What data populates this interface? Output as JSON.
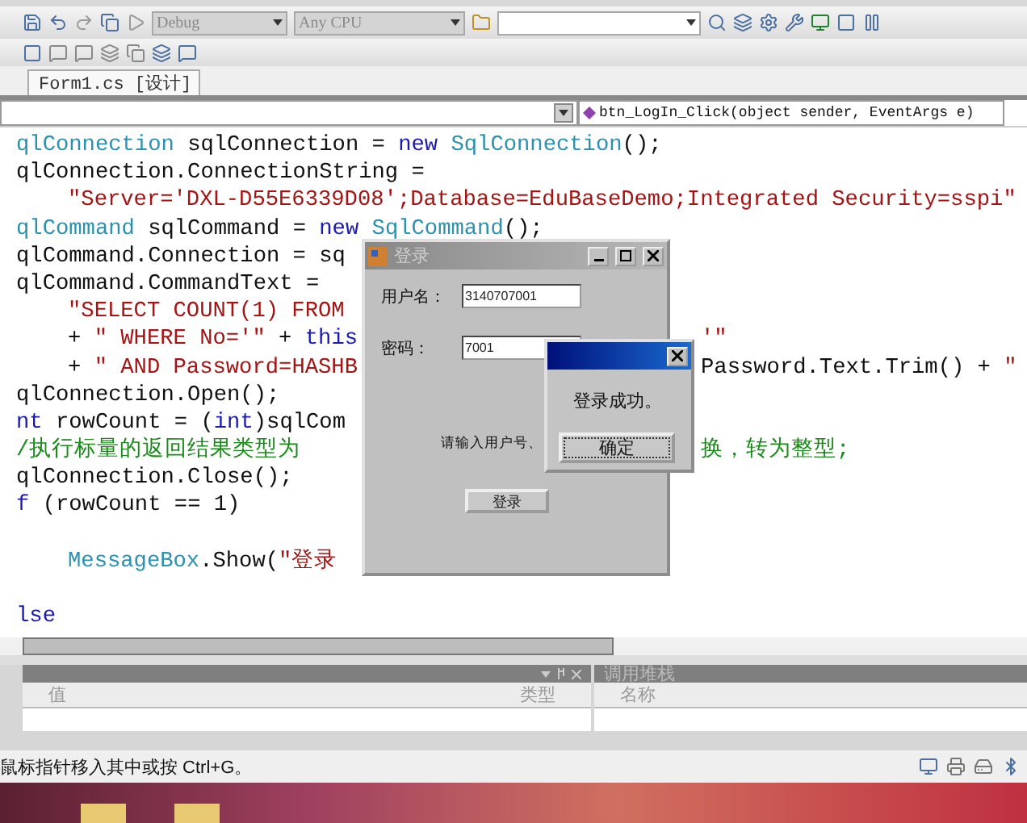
{
  "toolbar": {
    "configuration": "Debug",
    "platform": "Any CPU"
  },
  "document_tab": {
    "label": "Form1.cs [设计]",
    "selected": true
  },
  "nav_bar": {
    "member": "btn_LogIn_Click(object sender, EventArgs e)"
  },
  "code_lines": [
    {
      "indented": false,
      "blank_before": false,
      "segments": [
        {
          "kind": "type",
          "text": "qlConnection"
        },
        {
          "kind": "plain",
          "text": " sqlConnection = "
        },
        {
          "kind": "keyword",
          "text": "new"
        },
        {
          "kind": "type",
          "text": " SqlConnection"
        },
        {
          "kind": "plain",
          "text": "();"
        }
      ]
    },
    {
      "indented": false,
      "blank_before": false,
      "segments": [
        {
          "kind": "plain",
          "text": "qlConnection.ConnectionString ="
        }
      ]
    },
    {
      "indented": true,
      "blank_before": false,
      "segments": [
        {
          "kind": "string",
          "text": "\"Server='DXL-D55E6339D08';Database=EduBaseDemo;Integrated Security=sspi\""
        }
      ]
    },
    {
      "indented": false,
      "blank_before": false,
      "segments": [
        {
          "kind": "type",
          "text": "qlCommand"
        },
        {
          "kind": "plain",
          "text": " sqlCommand = "
        },
        {
          "kind": "keyword",
          "text": "new"
        },
        {
          "kind": "type",
          "text": " SqlCommand"
        },
        {
          "kind": "plain",
          "text": "();"
        }
      ]
    },
    {
      "indented": false,
      "blank_before": false,
      "segments": [
        {
          "kind": "plain",
          "text": "qlCommand.Connection = sq"
        }
      ]
    },
    {
      "indented": false,
      "blank_before": false,
      "segments": [
        {
          "kind": "plain",
          "text": "qlCommand.CommandText ="
        }
      ]
    },
    {
      "indented": true,
      "blank_before": false,
      "segments": [
        {
          "kind": "string",
          "text": "\"SELECT COUNT(1) FROM"
        }
      ]
    },
    {
      "indented": true,
      "blank_before": false,
      "segments": [
        {
          "kind": "plain",
          "text": "+ "
        },
        {
          "kind": "string",
          "text": "\" WHERE No='\""
        },
        {
          "kind": "plain",
          "text": " + "
        },
        {
          "kind": "keyword",
          "text": "this"
        }
      ],
      "tail": [
        {
          "kind": "string",
          "text": "'\""
        }
      ]
    },
    {
      "indented": true,
      "blank_before": false,
      "segments": [
        {
          "kind": "plain",
          "text": "+ "
        },
        {
          "kind": "string",
          "text": "\" AND Password=HASHB"
        }
      ],
      "tail": [
        {
          "kind": "plain",
          "text": "Password.Text.Trim() + "
        },
        {
          "kind": "string",
          "text": "\""
        }
      ]
    },
    {
      "indented": false,
      "blank_before": false,
      "segments": [
        {
          "kind": "plain",
          "text": "qlConnection.Open();"
        }
      ]
    },
    {
      "indented": false,
      "blank_before": false,
      "segments": [
        {
          "kind": "keyword",
          "text": "nt"
        },
        {
          "kind": "plain",
          "text": " rowCount = ("
        },
        {
          "kind": "keyword",
          "text": "int"
        },
        {
          "kind": "plain",
          "text": ")sqlCom"
        }
      ]
    },
    {
      "indented": false,
      "blank_before": false,
      "segments": [
        {
          "kind": "comment",
          "text": "/执行标量的返回结果类型为"
        }
      ],
      "tail": [
        {
          "kind": "comment",
          "text": "换，转为整型;"
        }
      ]
    },
    {
      "indented": false,
      "blank_before": false,
      "segments": [
        {
          "kind": "plain",
          "text": "qlConnection.Close();"
        }
      ]
    },
    {
      "indented": false,
      "blank_before": false,
      "segments": [
        {
          "kind": "keyword",
          "text": "f"
        },
        {
          "kind": "plain",
          "text": " (rowCount == 1)"
        }
      ]
    },
    {
      "indented": true,
      "blank_before": true,
      "segments": [
        {
          "kind": "type",
          "text": "MessageBox"
        },
        {
          "kind": "plain",
          "text": ".Show("
        },
        {
          "kind": "string",
          "text": "\"登录"
        }
      ]
    },
    {
      "indented": false,
      "blank_before": true,
      "segments": [
        {
          "kind": "keyword",
          "text": "lse"
        }
      ]
    }
  ],
  "bottom_panels": {
    "locals": {
      "columns": [
        "值",
        "类型"
      ]
    },
    "call_stack": {
      "title": "调用堆栈",
      "columns": [
        "名称"
      ]
    }
  },
  "status_bar": "鼠标指针移入其中或按 Ctrl+G。",
  "login_dialog": {
    "title": "登录",
    "fields": [
      {
        "label": "用户名：",
        "value": "3140707001"
      },
      {
        "label": "密码：",
        "value": "7001"
      }
    ],
    "hint": "请输入用户号、",
    "button": "登录"
  },
  "message_box": {
    "message": "登录成功。",
    "button": "确定"
  }
}
